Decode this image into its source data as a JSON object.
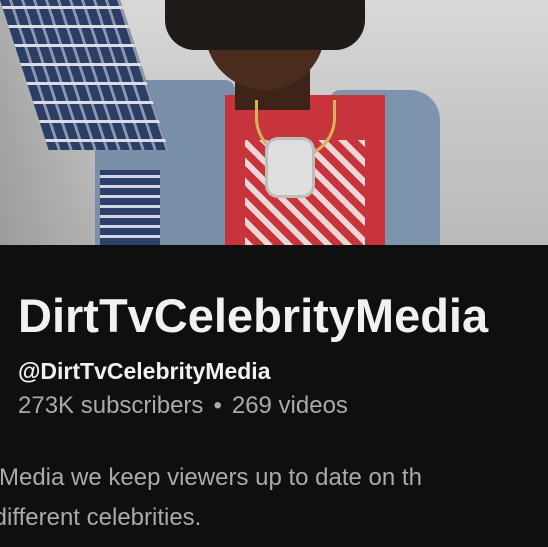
{
  "channel": {
    "name": "DirtTvCelebrityMedia",
    "handle": "@DirtTvCelebrityMedia",
    "subscribers": "273K subscribers",
    "separator": "•",
    "videos": "269 videos",
    "description_lines": [
      "rityMedia we keep viewers up to date on th",
      "of different celebrities."
    ]
  },
  "colors": {
    "background": "#0f0f0f",
    "primary_text": "#f1f1f1",
    "secondary_text": "#aaaaaa"
  }
}
